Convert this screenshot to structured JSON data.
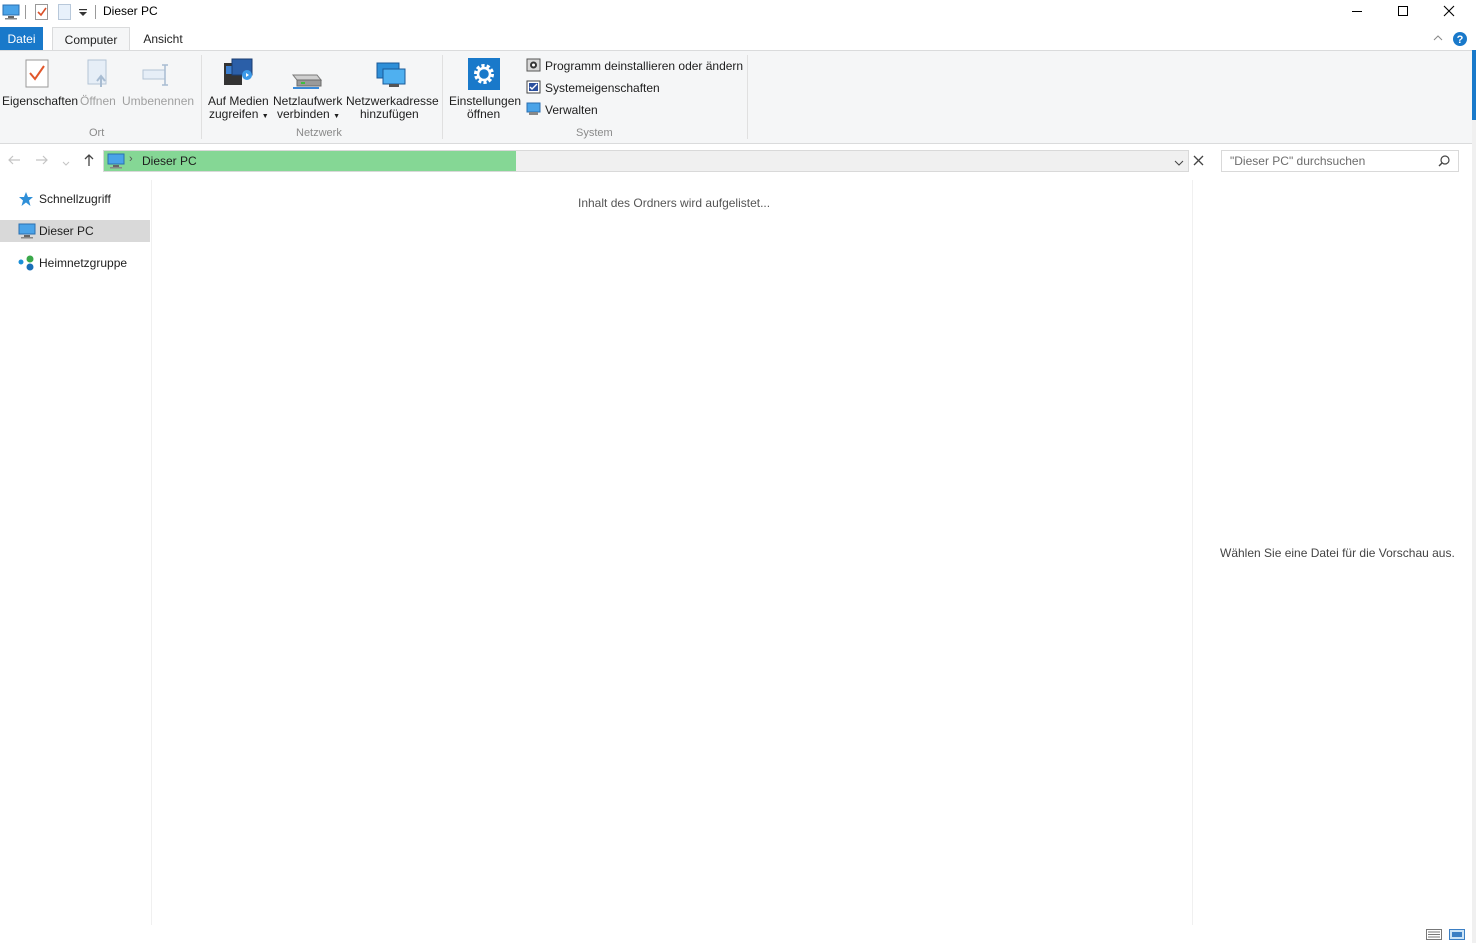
{
  "window": {
    "title": "Dieser PC",
    "icon": "computer-icon",
    "controls": [
      "minimize-icon",
      "maximize-icon",
      "close-icon"
    ]
  },
  "quick_access_toolbar": [
    "properties-icon",
    "new-folder-icon",
    "customize-dropdown-icon"
  ],
  "ribbon_tabs": [
    {
      "label": "Datei",
      "active_color": "#1979ca"
    },
    {
      "label": "Computer"
    },
    {
      "label": "Ansicht"
    }
  ],
  "ribbon": {
    "groups": {
      "ort": {
        "label": "Ort",
        "buttons": [
          {
            "label": "Eigenschaften",
            "icon": "properties-icon",
            "enabled": true
          },
          {
            "label": "Öffnen",
            "icon": "open-icon",
            "enabled": false
          },
          {
            "label": "Umbenennen",
            "icon": "rename-icon",
            "enabled": false
          }
        ]
      },
      "netzwerk": {
        "label": "Netzwerk",
        "buttons": [
          {
            "line1": "Auf Medien",
            "line2": "zugreifen",
            "icon": "media-access-icon",
            "dropdown": true
          },
          {
            "line1": "Netzlaufwerk",
            "line2": "verbinden",
            "icon": "network-drive-icon",
            "dropdown": true
          },
          {
            "line1": "Netzwerkadresse",
            "line2": "hinzufügen",
            "icon": "network-location-icon",
            "dropdown": false
          }
        ]
      },
      "system": {
        "label": "System",
        "big_button": {
          "line1": "Einstellungen",
          "line2": "öffnen",
          "icon": "settings-gear-icon"
        },
        "items": [
          {
            "label": "Programm deinstallieren oder ändern",
            "icon": "uninstall-program-icon"
          },
          {
            "label": "Systemeigenschaften",
            "icon": "system-properties-icon"
          },
          {
            "label": "Verwalten",
            "icon": "manage-icon"
          }
        ]
      }
    },
    "help_icon": "help-icon",
    "collapse_icon": "chevron-up-icon"
  },
  "address_bar": {
    "back_icon": "arrow-left-icon",
    "forward_icon": "arrow-right-icon",
    "recent_icon": "chevron-down-icon",
    "up_icon": "arrow-up-icon",
    "path": "Dieser PC",
    "progress_fraction": 0.38,
    "progress_color": "#85d795"
  },
  "search": {
    "placeholder": "\"Dieser PC\" durchsuchen",
    "icon": "search-icon"
  },
  "navigation_pane": [
    {
      "label": "Schnellzugriff",
      "icon": "star-icon",
      "selected": false
    },
    {
      "label": "Dieser PC",
      "icon": "computer-icon",
      "selected": true
    },
    {
      "label": "Heimnetzgruppe",
      "icon": "homegroup-icon",
      "selected": false
    }
  ],
  "content": {
    "status_text": "Inhalt des Ordners wird aufgelistet..."
  },
  "preview_pane": {
    "text": "Wählen Sie eine Datei für die Vorschau aus."
  },
  "status_bar": {
    "view_icons": [
      "details-view-icon",
      "large-icons-view-icon"
    ]
  }
}
